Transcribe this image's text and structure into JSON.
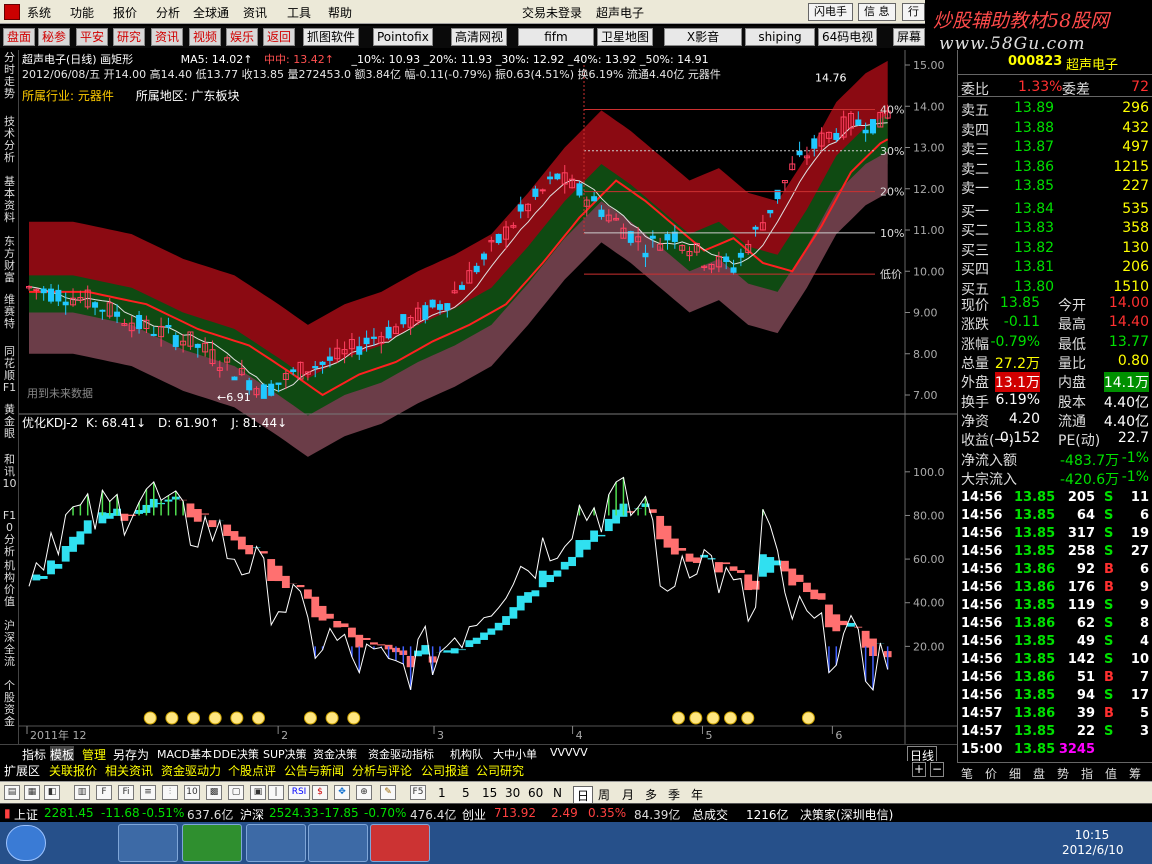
{
  "menubar": {
    "items": [
      "系统",
      "功能",
      "报价",
      "分析",
      "全球通",
      "资讯",
      "工具",
      "帮助"
    ],
    "login_status": "交易未登录",
    "title": "超声电子",
    "buttons": [
      "闪电手",
      "信 息",
      "行"
    ]
  },
  "banner": {
    "line1": "炒股辅助教材58股网",
    "line2": "www.58Gu.com"
  },
  "quickbar": {
    "red": [
      "盘面",
      "秘参",
      "平安",
      "研究",
      "资讯",
      "视频",
      "娱乐",
      "返回"
    ],
    "black": [
      "抓图软件",
      "Pointofix",
      "高清网视",
      "fifm",
      "卫星地图",
      "X影音",
      "shiping",
      "64码电视",
      "屏幕"
    ]
  },
  "leftnav": [
    "分时走势",
    "技术分析",
    "基本资料",
    "东方财富",
    "维赛特",
    "同花顺F1",
    "黄金眼",
    "和讯10",
    "F10分析",
    "机构价值",
    "沪深全流",
    "个股资金"
  ],
  "chart_header": {
    "line1": "超声电子(日线) 画矩形",
    "ma5": "MA5: 14.02↑",
    "mid": "中中: 13.42↑",
    "levels": "_10%: 10.93  _20%: 11.93  _30%: 12.92  _40%: 13.92  _50%: 14.91",
    "line2": "2012/06/08/五 开14.00 高14.40 低13.77 收13.85 量272453.0 额3.84亿 幅-0.11(-0.79%) 振0.63(4.51%) 换6.19% 流通4.40亿 元器件",
    "industry": "所属行业: 元器件",
    "region": "所属地区: 广东板块",
    "low_label": "←6.91",
    "high_label": "14.76",
    "future_data": "用到未来数据",
    "pct_labels": [
      "40%",
      "30%",
      "20%",
      "10%",
      "低价"
    ]
  },
  "kdj": {
    "title": "优化KDJ-2",
    "k": "K: 68.41↓",
    "d": "D: 61.90↑",
    "j": "J: 81.44↓"
  },
  "price_axis": [
    "15.00",
    "14.00",
    "13.00",
    "12.00",
    "11.00",
    "10.00",
    "9.00",
    "8.00",
    "7.00"
  ],
  "kdj_axis": [
    "100.0",
    "80.00",
    "60.00",
    "40.00",
    "20.00"
  ],
  "time_axis": [
    "2011年 12",
    "2",
    "3",
    "4",
    "5",
    "6"
  ],
  "period_label": "日线",
  "quote": {
    "code": "000823",
    "name": "超声电子",
    "weibi_label": "委比",
    "weibi": "1.33%",
    "weicha_label": "委差",
    "weicha": "72",
    "sells": [
      {
        "label": "卖五",
        "price": "13.89",
        "vol": "296"
      },
      {
        "label": "卖四",
        "price": "13.88",
        "vol": "432"
      },
      {
        "label": "卖三",
        "price": "13.87",
        "vol": "497"
      },
      {
        "label": "卖二",
        "price": "13.86",
        "vol": "1215"
      },
      {
        "label": "卖一",
        "price": "13.85",
        "vol": "227"
      }
    ],
    "buys": [
      {
        "label": "买一",
        "price": "13.84",
        "vol": "535"
      },
      {
        "label": "买二",
        "price": "13.83",
        "vol": "358"
      },
      {
        "label": "买三",
        "price": "13.82",
        "vol": "130"
      },
      {
        "label": "买四",
        "price": "13.81",
        "vol": "206"
      },
      {
        "label": "买五",
        "price": "13.80",
        "vol": "1510"
      }
    ],
    "stats": [
      [
        "现价",
        "13.85",
        "今开",
        "14.00"
      ],
      [
        "涨跌",
        "-0.11",
        "最高",
        "14.40"
      ],
      [
        "涨幅",
        "-0.79%",
        "最低",
        "13.77"
      ],
      [
        "总量",
        "27.2万",
        "量比",
        "0.80"
      ],
      [
        "外盘",
        "13.1万",
        "内盘",
        "14.1万"
      ],
      [
        "换手",
        "6.19%",
        "股本",
        "4.40亿"
      ],
      [
        "净资",
        "4.20",
        "流通",
        "4.40亿"
      ],
      [
        "收益(一)",
        "0.152",
        "PE(动)",
        "22.7"
      ]
    ],
    "flows": [
      [
        "净流入额",
        "-483.7万",
        "-1%"
      ],
      [
        "大宗流入",
        "-420.6万",
        "-1%"
      ]
    ]
  },
  "ticks": [
    [
      "14:56",
      "13.85",
      "205",
      "S",
      "11"
    ],
    [
      "14:56",
      "13.85",
      "64",
      "S",
      "6"
    ],
    [
      "14:56",
      "13.85",
      "317",
      "S",
      "19"
    ],
    [
      "14:56",
      "13.85",
      "258",
      "S",
      "27"
    ],
    [
      "14:56",
      "13.86",
      "92",
      "B",
      "6"
    ],
    [
      "14:56",
      "13.86",
      "176",
      "B",
      "9"
    ],
    [
      "14:56",
      "13.85",
      "119",
      "S",
      "9"
    ],
    [
      "14:56",
      "13.86",
      "62",
      "S",
      "8"
    ],
    [
      "14:56",
      "13.85",
      "49",
      "S",
      "4"
    ],
    [
      "14:56",
      "13.85",
      "142",
      "S",
      "10"
    ],
    [
      "14:56",
      "13.86",
      "51",
      "B",
      "7"
    ],
    [
      "14:56",
      "13.85",
      "94",
      "S",
      "17"
    ],
    [
      "14:57",
      "13.86",
      "39",
      "B",
      "5"
    ],
    [
      "14:57",
      "13.85",
      "22",
      "S",
      "3"
    ],
    [
      "15:00",
      "13.85",
      "3245",
      "",
      ""
    ]
  ],
  "right_tabs": [
    "笔",
    "价",
    "细",
    "盘",
    "势",
    "指",
    "值",
    "筹"
  ],
  "bottom_tabs1": [
    "指标",
    "模板",
    "管理",
    "另存为",
    "MACD基本",
    "DDE决策",
    "SUP决策",
    "资金决策",
    "资金驱动指标",
    "机构队",
    "大中小单",
    "VVVVV"
  ],
  "bottom_tabs2": [
    "扩展区",
    "关联报价",
    "相关资讯",
    "资金驱动力",
    "个股点评",
    "公告与新闻",
    "分析与评论",
    "公司报道",
    "公司研究"
  ],
  "toolbar": {
    "periods": [
      "1",
      "5",
      "15",
      "30",
      "60",
      "N",
      "日",
      "周",
      "月",
      "多",
      "季",
      "年"
    ]
  },
  "status": {
    "sh_label": "上证",
    "sh": "2281.45",
    "sh_chg": "-11.68",
    "sh_pct": "-0.51%",
    "sh_amt": "637.6亿",
    "hs_label": "沪深",
    "hs": "2524.33",
    "hs_chg": "-17.85",
    "hs_pct": "-0.70%",
    "hs_amt": "476.4亿",
    "cy_label": "创业",
    "cy": "713.92",
    "cy_chg": "2.49",
    "cy_pct": "0.35%",
    "cy_amt": "84.39亿",
    "total_label": "总成交",
    "total": "1216亿",
    "app": "决策家(深圳电信)"
  },
  "clock": {
    "time": "10:15",
    "date": "2012/6/10"
  }
}
